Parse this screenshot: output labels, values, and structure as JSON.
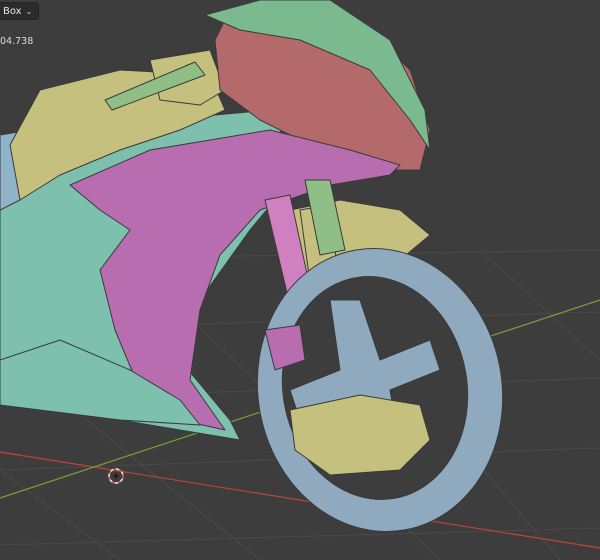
{
  "header": {
    "mode_dropdown_label": "Box",
    "mode_dropdown_icon": "chevron-down-icon"
  },
  "overlay": {
    "stat_value": "04.738"
  },
  "colors": {
    "background": "#3d3d3d",
    "grid_line": "#4a4a4a",
    "x_axis": "#c0423d",
    "y_axis": "#79a03a",
    "tire": "#8fa9bf",
    "fairing_purple": "#b86db0",
    "fairing_red": "#b46a6a",
    "fairing_green": "#7bb98f",
    "body_yellow": "#c6c07e",
    "frame_teal": "#7cc0ad"
  },
  "icons": {
    "cursor": "3d-cursor-icon"
  }
}
